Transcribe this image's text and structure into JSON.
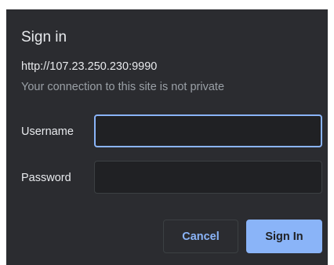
{
  "dialog": {
    "title": "Sign in",
    "url": "http://107.23.250.230:9990",
    "warning": "Your connection to this site is not private",
    "username": {
      "label": "Username",
      "value": ""
    },
    "password": {
      "label": "Password",
      "value": ""
    },
    "buttons": {
      "cancel": "Cancel",
      "sign_in": "Sign In"
    },
    "colors": {
      "background": "#2b2c30",
      "accent": "#8ab4f8",
      "input_background": "#202124",
      "text": "#e8eaed",
      "muted_text": "#9aa0a6"
    }
  }
}
